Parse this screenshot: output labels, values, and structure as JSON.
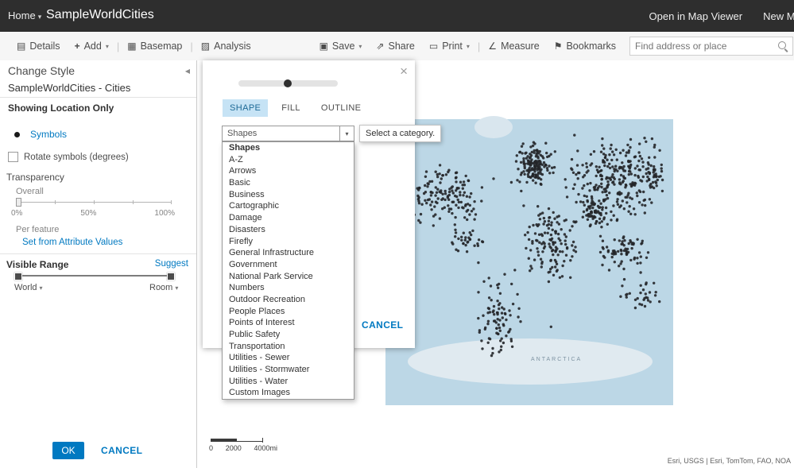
{
  "header": {
    "home": "Home",
    "title": "SampleWorldCities",
    "open_in_map_viewer": "Open in Map Viewer",
    "new_map": "New Map"
  },
  "toolbar": {
    "details": "Details",
    "add": "Add",
    "basemap": "Basemap",
    "analysis": "Analysis",
    "save": "Save",
    "share": "Share",
    "print": "Print",
    "measure": "Measure",
    "bookmarks": "Bookmarks",
    "search_placeholder": "Find address or place"
  },
  "icons": {
    "caret": "▾",
    "details": "▤",
    "add": "+",
    "basemap": "▦",
    "analysis": "▨",
    "save": "▣",
    "share": "⇗",
    "print": "▭",
    "measure": "∠",
    "bookmarks": "⚑",
    "collapse": "◀",
    "close": "×"
  },
  "panel": {
    "title": "Change Style",
    "layer_name": "SampleWorldCities - Cities",
    "showing_label": "Showing Location Only",
    "symbols_link": "Symbols",
    "rotate_label": "Rotate symbols (degrees)",
    "transparency": {
      "label": "Transparency",
      "overall_label": "Overall",
      "ticks": [
        "0%",
        "50%",
        "100%"
      ],
      "per_feature_label": "Per feature",
      "attribute_link": "Set from Attribute Values"
    },
    "visible_range": {
      "label": "Visible Range",
      "suggest_link": "Suggest",
      "min_label": "World",
      "max_label": "Room"
    },
    "ok_label": "OK",
    "cancel_label": "CANCEL"
  },
  "dialog": {
    "tabs": [
      "SHAPE",
      "FILL",
      "OUTLINE"
    ],
    "active_tab": "SHAPE",
    "dropdown_value": "Shapes",
    "categories": [
      "Shapes",
      "A-Z",
      "Arrows",
      "Basic",
      "Business",
      "Cartographic",
      "Damage",
      "Disasters",
      "Firefly",
      "General Infrastructure",
      "Government",
      "National Park Service",
      "Numbers",
      "Outdoor Recreation",
      "People Places",
      "Points of Interest",
      "Public Safety",
      "Transportation",
      "Utilities - Sewer",
      "Utilities - Stormwater",
      "Utilities - Water",
      "Custom Images"
    ],
    "cancel_label": "CANCEL",
    "tooltip": "Select a category."
  },
  "map": {
    "antarctica_label": "ANTARCTICA",
    "scale_labels": [
      "0",
      "2000",
      "4000mi"
    ],
    "attribution": "Esri, USGS | Esri, TomTom, FAO, NOA"
  },
  "colors": {
    "accent_blue": "#0079c1",
    "header_bg": "#2e2e2e",
    "ocean": "#bcd7e6",
    "active_tab_bg": "#c6e3f5"
  }
}
